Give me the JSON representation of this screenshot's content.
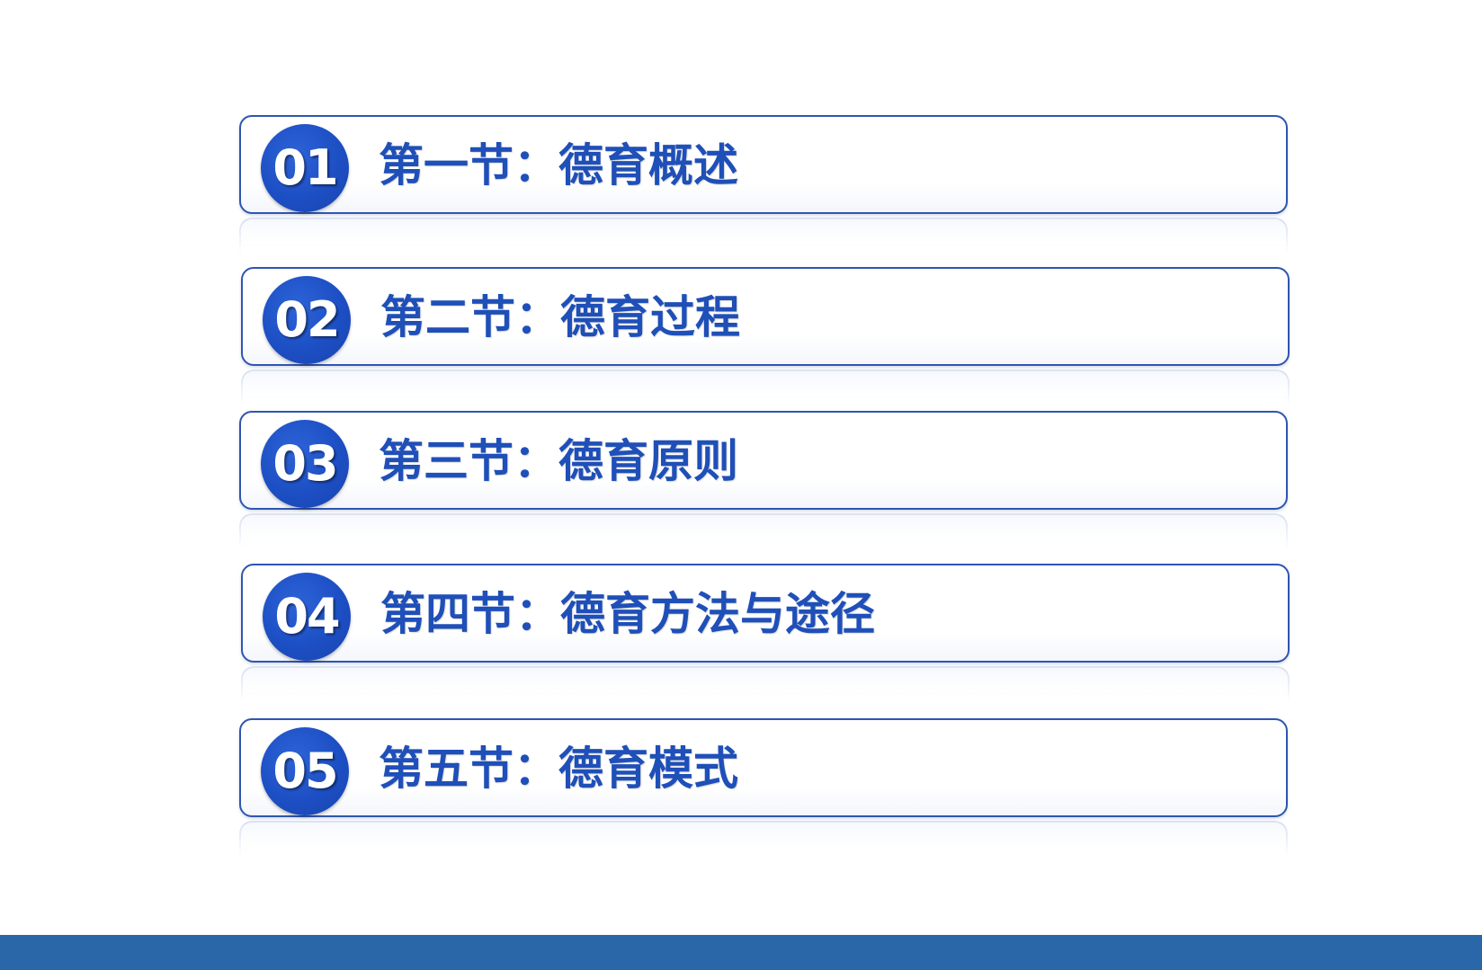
{
  "slide": {
    "toc_items": [
      {
        "number": "01",
        "title": "第一节：德育概述"
      },
      {
        "number": "02",
        "title": "第二节：德育过程"
      },
      {
        "number": "03",
        "title": "第三节：德育原则"
      },
      {
        "number": "04",
        "title": "第四节：德育方法与途径"
      },
      {
        "number": "05",
        "title": "第五节：德育模式"
      }
    ]
  },
  "colors": {
    "accent_blue": "#1d4fc4",
    "title_blue": "#1f4fb8",
    "border_blue": "#2f55b0",
    "bottom_bar": "#2a67a8",
    "background": "#ffffff"
  }
}
